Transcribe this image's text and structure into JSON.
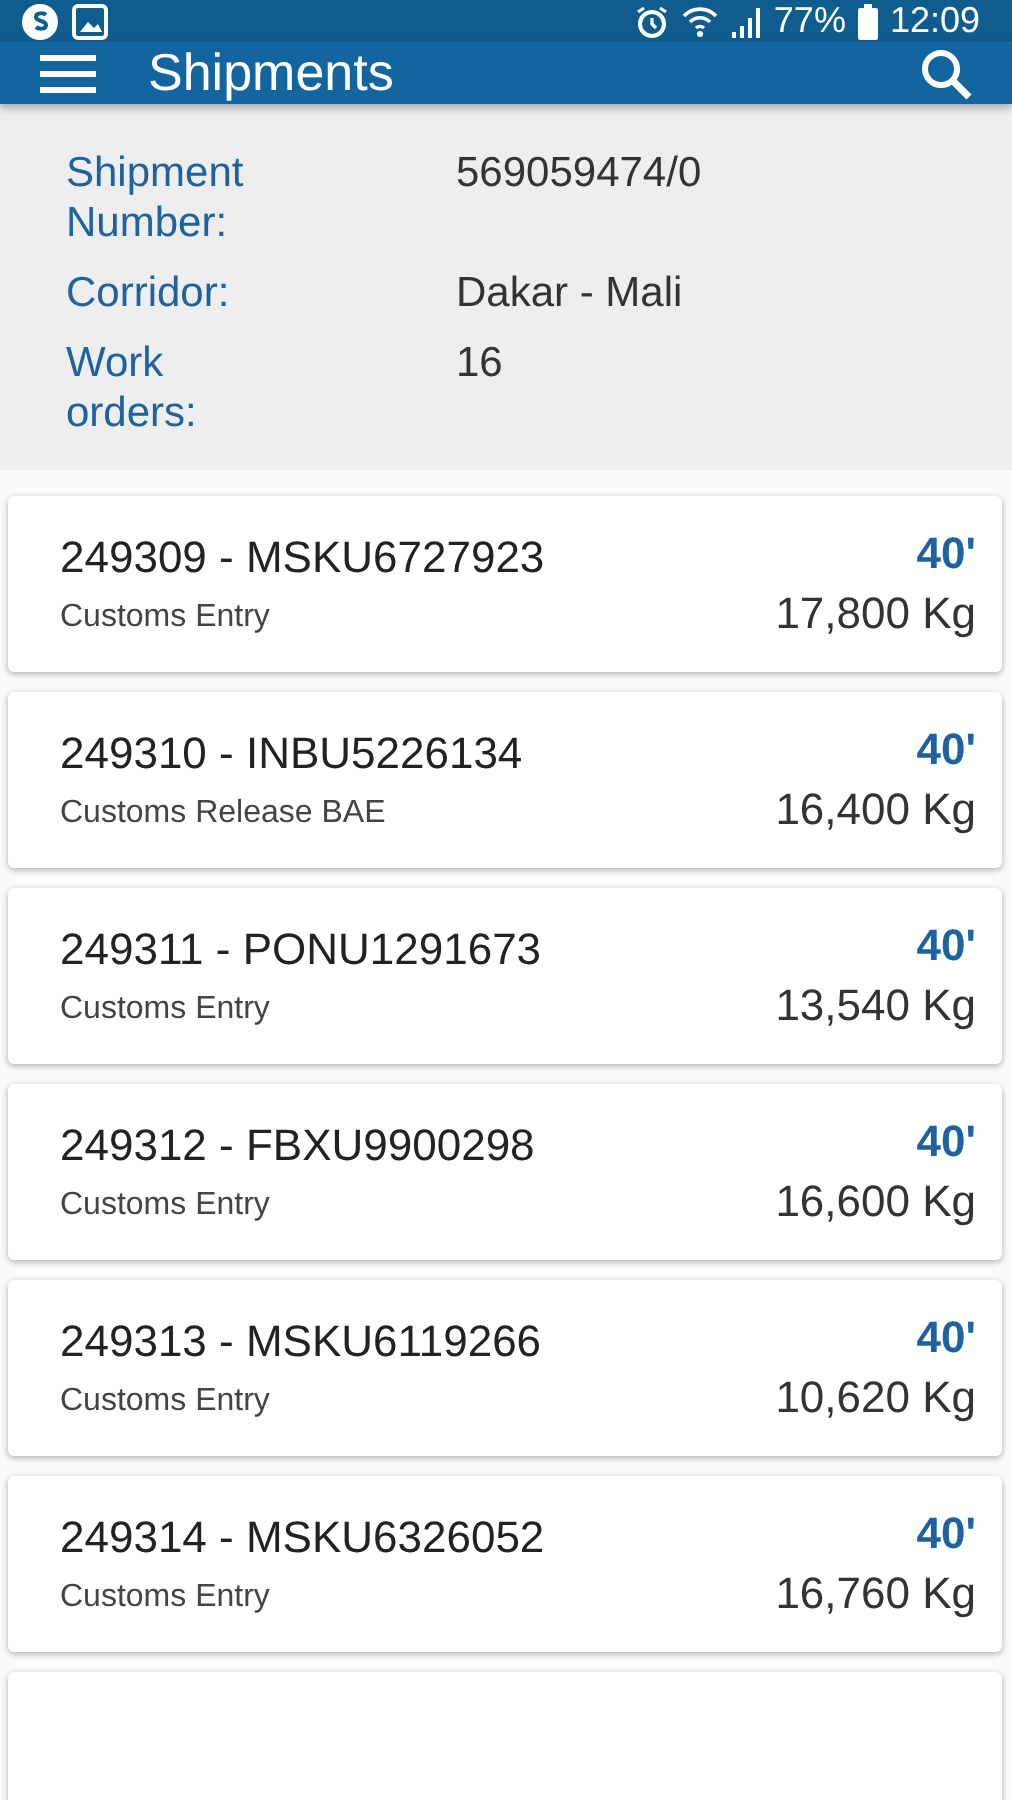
{
  "status_bar": {
    "battery": "77%",
    "time": "12:09"
  },
  "app_bar": {
    "title": "Shipments"
  },
  "summary": [
    {
      "label": "Shipment Number:",
      "value": "569059474/0"
    },
    {
      "label": "Corridor:",
      "value": "Dakar - Mali"
    },
    {
      "label": "Work orders:",
      "value": "16"
    }
  ],
  "work_orders": [
    {
      "title": "249309 - MSKU6727923",
      "status": "Customs Entry",
      "size": "40'",
      "weight": "17,800 Kg"
    },
    {
      "title": "249310 - INBU5226134",
      "status": "Customs Release BAE",
      "size": "40'",
      "weight": "16,400 Kg"
    },
    {
      "title": "249311 - PONU1291673",
      "status": "Customs Entry",
      "size": "40'",
      "weight": "13,540 Kg"
    },
    {
      "title": "249312 - FBXU9900298",
      "status": "Customs Entry",
      "size": "40'",
      "weight": "16,600 Kg"
    },
    {
      "title": "249313 - MSKU6119266",
      "status": "Customs Entry",
      "size": "40'",
      "weight": "10,620 Kg"
    },
    {
      "title": "249314 - MSKU6326052",
      "status": "Customs Entry",
      "size": "40'",
      "weight": "16,760 Kg"
    }
  ]
}
